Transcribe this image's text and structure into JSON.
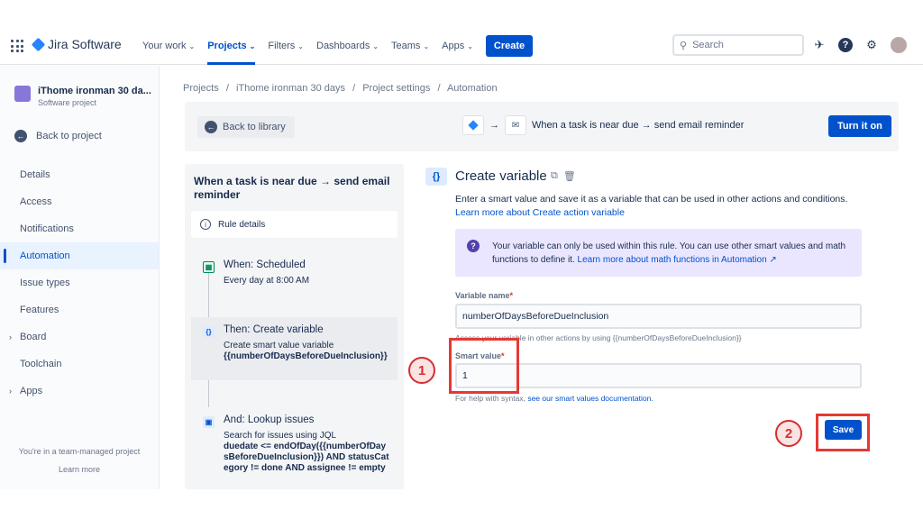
{
  "nav": {
    "brand": "Jira Software",
    "items": [
      {
        "label": "Your work",
        "active": false
      },
      {
        "label": "Projects",
        "active": true
      },
      {
        "label": "Filters",
        "active": false
      },
      {
        "label": "Dashboards",
        "active": false
      },
      {
        "label": "Teams",
        "active": false
      },
      {
        "label": "Apps",
        "active": false
      }
    ],
    "create_label": "Create",
    "search_placeholder": "Search"
  },
  "sidebar": {
    "project_name": "iThome ironman 30 da...",
    "project_type": "Software project",
    "back_label": "Back to project",
    "items": [
      {
        "label": "Details"
      },
      {
        "label": "Access"
      },
      {
        "label": "Notifications"
      },
      {
        "label": "Automation"
      },
      {
        "label": "Issue types"
      },
      {
        "label": "Features"
      },
      {
        "label": "Board"
      },
      {
        "label": "Toolchain"
      },
      {
        "label": "Apps"
      }
    ],
    "footer_text": "You're in a team-managed project",
    "learn_more": "Learn more"
  },
  "breadcrumb": {
    "items": [
      "Projects",
      "iThome ironman 30 days",
      "Project settings",
      "Automation"
    ],
    "separator": "/"
  },
  "toolbar": {
    "back_label": "Back to library",
    "arrow": "→",
    "flow_text": "When a task is near due → send email reminder",
    "turn_on_label": "Turn it on"
  },
  "rule": {
    "title": "When a task is near due → send email reminder",
    "details_label": "Rule details",
    "steps": [
      {
        "title": "When: Scheduled",
        "desc": "Every day at 8:00 AM",
        "desc_bold": ""
      },
      {
        "title": "Then: Create variable",
        "desc": "Create smart value variable",
        "desc_bold": "{{numberOfDaysBeforeDueInclusion}}"
      },
      {
        "title": "And: Lookup issues",
        "desc": "Search for issues using JQL",
        "desc_bold": "duedate <= endOfDay({{numberOfDaysBeforeDueInclusion}}) AND statusCategory != done AND assignee != empty"
      }
    ]
  },
  "create_variable": {
    "icon_text": "{}",
    "title": "Create variable",
    "desc": "Enter a smart value and save it as a variable that can be used in other actions and conditions.",
    "desc_link": "Learn more about Create action variable",
    "info_text": "Your variable can only be used within this rule. You can use other smart values and math functions to define it.",
    "info_link": "Learn more about math functions in Automation ↗",
    "variable_name_label": "Variable name",
    "variable_name_value": "numberOfDaysBeforeDueInclusion",
    "variable_name_help": "Access your variable in other actions by using {{numberOfDaysBeforeDueInclusion}}",
    "smart_value_label": "Smart value",
    "smart_value_value": "1",
    "smart_value_help": "For help with syntax,",
    "smart_value_help_link": "see our smart values documentation.",
    "save_label": "Save"
  },
  "annotations": {
    "badge1": "1",
    "badge2": "2"
  },
  "colors": {
    "brand": "#0052cc",
    "highlight": "#e53935",
    "info_bg": "#eae6ff"
  }
}
